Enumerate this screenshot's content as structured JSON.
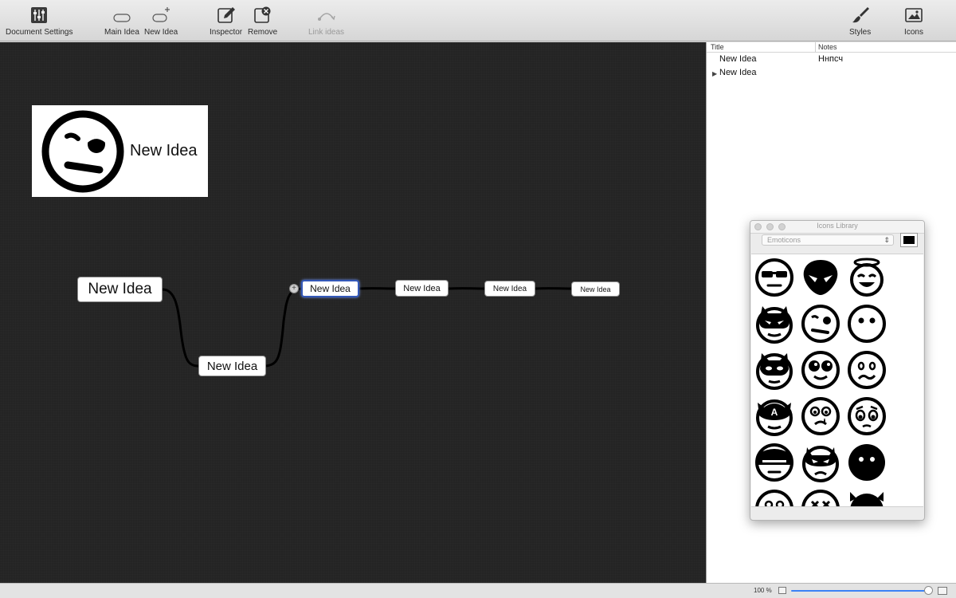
{
  "toolbar": {
    "document_settings": "Document Settings",
    "main_idea": "Main Idea",
    "new_idea": "New Idea",
    "inspector": "Inspector",
    "remove": "Remove",
    "link_ideas": "Link ideas",
    "styles": "Styles",
    "icons": "Icons"
  },
  "canvas": {
    "icon_node_label": "New Idea",
    "nodes": [
      "New Idea",
      "New Idea",
      "New Idea",
      "New Idea",
      "New Idea",
      "New Idea"
    ]
  },
  "outline": {
    "col_title": "Title",
    "col_notes": "Notes",
    "rows": [
      {
        "title": "New Idea",
        "notes": "Ннпсч"
      },
      {
        "title": "New Idea",
        "notes": ""
      }
    ]
  },
  "icons_library": {
    "title": "Icons Library",
    "category": "Emoticons",
    "color": "#000000"
  },
  "status": {
    "zoom": "100 %",
    "zoom_fraction": 1.0
  },
  "colors": {
    "canvas_bg": "#242424",
    "selection": "#3458b8",
    "slider": "#3b82f6"
  }
}
